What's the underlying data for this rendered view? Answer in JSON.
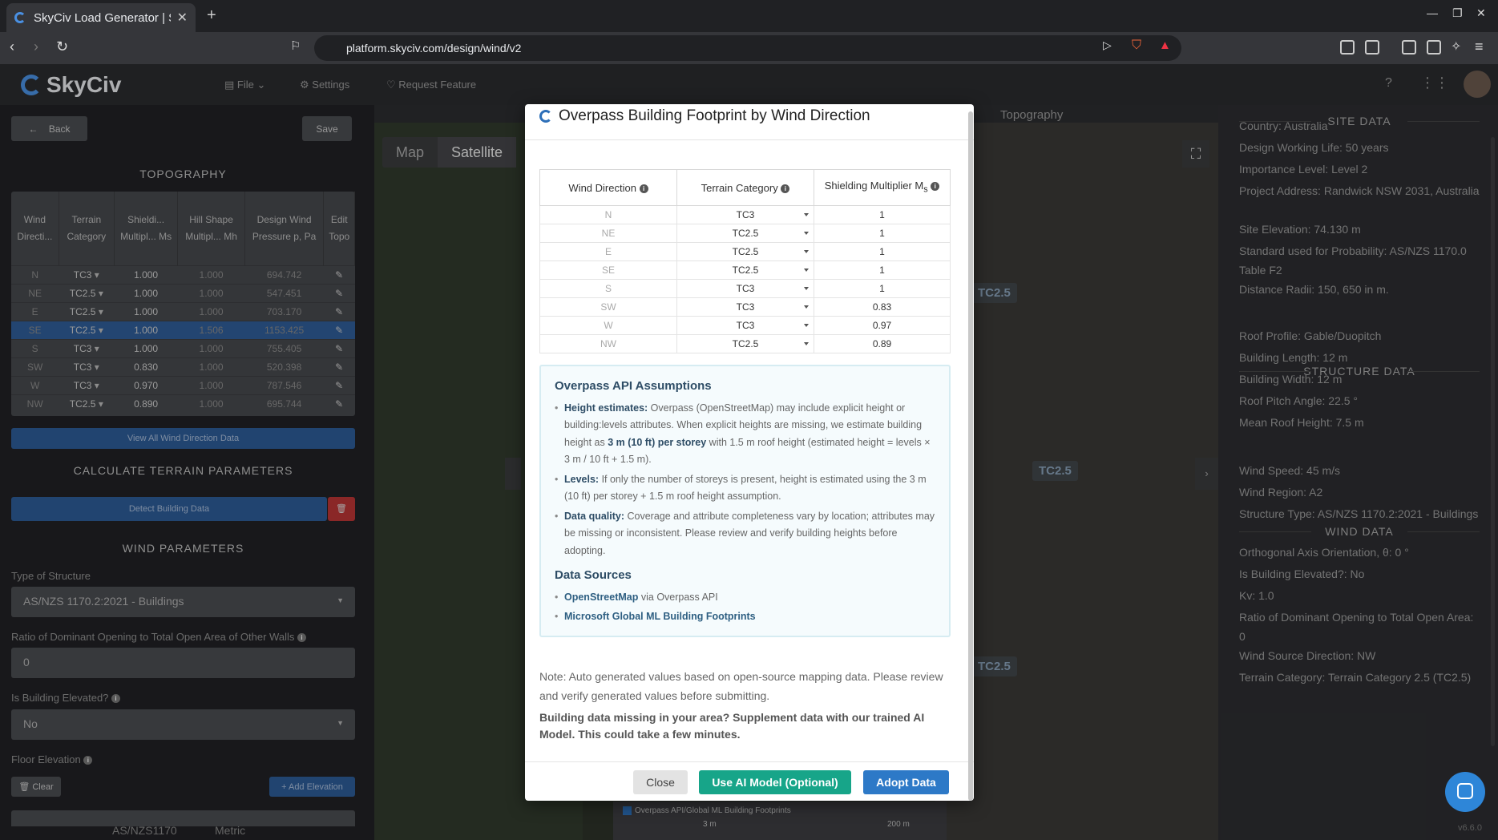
{
  "browser": {
    "tab_title": "SkyCiv Load Generator | S",
    "url": "platform.skyciv.com/design/wind/v2"
  },
  "header": {
    "logo_text": "SkyCiv",
    "menu": {
      "file": "File",
      "settings": "Settings",
      "request": "Request Feature"
    }
  },
  "left": {
    "back_label": "Back",
    "save_label": "Save",
    "topography_title": "TOPOGRAPHY",
    "table_headers": [
      "Wind Directi...",
      "Terrain Category",
      "Shieldi... Multipl... Ms",
      "Hill Shape Multipl... Mh",
      "Design Wind Pressure p, Pa",
      "Edit Topo"
    ],
    "rows": [
      {
        "dir": "N",
        "tc": "TC3",
        "ms": "1.000",
        "mh": "1.000",
        "p": "694.742"
      },
      {
        "dir": "NE",
        "tc": "TC2.5",
        "ms": "1.000",
        "mh": "1.000",
        "p": "547.451"
      },
      {
        "dir": "E",
        "tc": "TC2.5",
        "ms": "1.000",
        "mh": "1.000",
        "p": "703.170"
      },
      {
        "dir": "SE",
        "tc": "TC2.5",
        "ms": "1.000",
        "mh": "1.506",
        "p": "1153.425"
      },
      {
        "dir": "S",
        "tc": "TC3",
        "ms": "1.000",
        "mh": "1.000",
        "p": "755.405"
      },
      {
        "dir": "SW",
        "tc": "TC3",
        "ms": "0.830",
        "mh": "1.000",
        "p": "520.398"
      },
      {
        "dir": "W",
        "tc": "TC3",
        "ms": "0.970",
        "mh": "1.000",
        "p": "787.546"
      },
      {
        "dir": "NW",
        "tc": "TC2.5",
        "ms": "0.890",
        "mh": "1.000",
        "p": "695.744"
      }
    ],
    "view_all": "View All Wind Direction Data",
    "calc_title": "CALCULATE TERRAIN PARAMETERS",
    "detect_label": "Detect Building Data",
    "wind_params_title": "WIND PARAMETERS",
    "structure_label": "Type of Structure",
    "structure_value": "AS/NZS 1170.2:2021 - Buildings",
    "ratio_label": "Ratio of Dominant Opening to Total Open Area of Other Walls",
    "ratio_value": "0",
    "elevated_label": "Is Building Elevated?",
    "elevated_value": "No",
    "floor_label": "Floor Elevation",
    "clear_label": "Clear",
    "add_elev_label": "+ Add Elevation",
    "footer_std": "AS/NZS1170",
    "footer_units": "Metric"
  },
  "map": {
    "tab_map": "Map",
    "tab_satellite": "Satellite",
    "topo_label": "Topography",
    "labels": [
      "TC2.5",
      "TC2.5",
      "TC2.5"
    ],
    "legend_check": "Overpass API/Global ML Building Footprints",
    "scale_left": "3 m",
    "scale_right": "200 m"
  },
  "modal": {
    "title": "Overpass Building Footprint by Wind Direction",
    "col_dir": "Wind Direction",
    "col_tc": "Terrain Category",
    "col_ms": "Shielding Multiplier M",
    "col_ms_sub": "s",
    "rows": [
      {
        "dir": "N",
        "tc": "TC3",
        "ms": "1"
      },
      {
        "dir": "NE",
        "tc": "TC2.5",
        "ms": "1"
      },
      {
        "dir": "E",
        "tc": "TC2.5",
        "ms": "1"
      },
      {
        "dir": "SE",
        "tc": "TC2.5",
        "ms": "1"
      },
      {
        "dir": "S",
        "tc": "TC3",
        "ms": "1"
      },
      {
        "dir": "SW",
        "tc": "TC3",
        "ms": "0.83"
      },
      {
        "dir": "W",
        "tc": "TC3",
        "ms": "0.97"
      },
      {
        "dir": "NW",
        "tc": "TC2.5",
        "ms": "0.89"
      }
    ],
    "assump_title": "Overpass API Assumptions",
    "a1_head": "Height estimates:",
    "a1_text1": " Overpass (OpenStreetMap) may include explicit height or building:levels attributes. When explicit heights are missing, we estimate building height as ",
    "a1_bold": "3 m (10 ft) per storey",
    "a1_text2": " with 1.5 m roof height (estimated height = levels × 3 m / 10 ft + 1.5 m).",
    "a2_head": "Levels:",
    "a2_text": " If only the number of storeys is present, height is estimated using the 3 m (10 ft) per storey + 1.5 m roof height assumption.",
    "a3_head": "Data quality:",
    "a3_text": " Coverage and attribute completeness vary by location; attributes may be missing or inconsistent. Please review and verify building heights before adopting.",
    "sources_title": "Data Sources",
    "s1_link": "OpenStreetMap",
    "s1_text": " via Overpass API",
    "s2_link": "Microsoft Global ML Building Footprints",
    "note": "Note: Auto generated values based on open-source mapping data. Please review and verify generated values before submitting.",
    "note2": "Building data missing in your area? Supplement data with our trained AI Model. This could take a few minutes.",
    "close_label": "Close",
    "ai_label": "Use AI Model (Optional)",
    "adopt_label": "Adopt Data"
  },
  "right": {
    "site_title": "SITE DATA",
    "site": [
      "Country: Australia",
      "Design Working Life: 50 years",
      "Importance Level: Level 2",
      "Project Address: Randwick NSW 2031, Australia",
      "Site Elevation: 74.130 m",
      "Standard used for Probability: AS/NZS 1170.0 Table F2",
      "Distance Radii: 150, 650 in m."
    ],
    "structure_title": "STRUCTURE DATA",
    "structure": [
      "Roof Profile: Gable/Duopitch",
      "Building Length: 12 m",
      "Building Width: 12 m",
      "Roof Pitch Angle: 22.5 °",
      "Mean Roof Height: 7.5 m"
    ],
    "wind_title": "WIND DATA",
    "wind": [
      "Wind Speed: 45 m/s",
      "Wind Region: A2",
      "Structure Type: AS/NZS 1170.2:2021 - Buildings",
      "Orthogonal Axis Orientation, θ: 0 °",
      "Is Building Elevated?: No",
      "Kv: 1.0",
      "Ratio of Dominant Opening to Total Open Area: 0",
      "Wind Source Direction: NW",
      "Terrain Category: Terrain Category 2.5 (TC2.5)"
    ],
    "version": "v6.6.0"
  },
  "colors": {
    "accent": "#2d6fb8",
    "teal": "#17a589",
    "adopt": "#2d79c7"
  }
}
